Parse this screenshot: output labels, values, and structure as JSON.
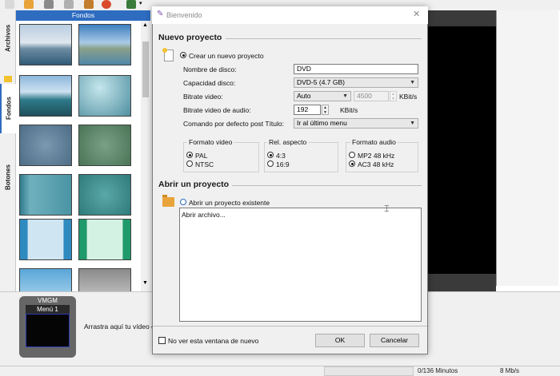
{
  "app": {
    "panel_header": "Fondos",
    "left_tabs": [
      "Archivos",
      "Fondos",
      "Botones"
    ],
    "vmgm": {
      "title": "VMGM",
      "menu": "Menú 1"
    },
    "drag_hint": "Arrastra aquí tu vídeo d",
    "status": {
      "minutes": "0/136 Minutos",
      "bitrate": "8 Mb/s"
    },
    "colors": {
      "panel_header": "#2e6cc0",
      "dialog_bg": "#f0f0f0",
      "thumb_border": "#404040"
    }
  },
  "dialog": {
    "title": "Bienvenido",
    "new_project": {
      "section_title": "Nuevo proyecto",
      "create_radio": "Crear un nuevo proyecto",
      "disc_name_label": "Nombre de disco:",
      "disc_name_value": "DVD",
      "capacity_label": "Capacidad disco:",
      "capacity_value": "DVD-5 (4.7 GB)",
      "video_bitrate_label": "Bitrate video:",
      "video_bitrate_mode": "Auto",
      "video_bitrate_value": "4500",
      "video_bitrate_unit": "KBit/s",
      "audio_bitrate_label": "Bitrate video de audio:",
      "audio_bitrate_value": "192",
      "audio_bitrate_unit": "KBit/s",
      "post_cmd_label": "Comando por defecto post Título:",
      "post_cmd_value": "Ir al último menu",
      "video_format": {
        "title": "Formato video",
        "options": [
          "PAL",
          "NTSC"
        ],
        "selected": "PAL"
      },
      "aspect": {
        "title": "Rel. aspecto",
        "options": [
          "4:3",
          "16:9"
        ],
        "selected": "4:3"
      },
      "audio_format": {
        "title": "Formato audio",
        "options": [
          "MP2 48 kHz",
          "AC3 48 kHz"
        ],
        "selected": "AC3 48 kHz"
      }
    },
    "open_project": {
      "section_title": "Abrir un proyecto",
      "open_radio": "Abrir un proyecto existente",
      "list_items": [
        "Abrir archivo..."
      ]
    },
    "dont_show_label": "No ver esta ventana de nuevo",
    "ok_label": "OK",
    "cancel_label": "Cancelar"
  }
}
